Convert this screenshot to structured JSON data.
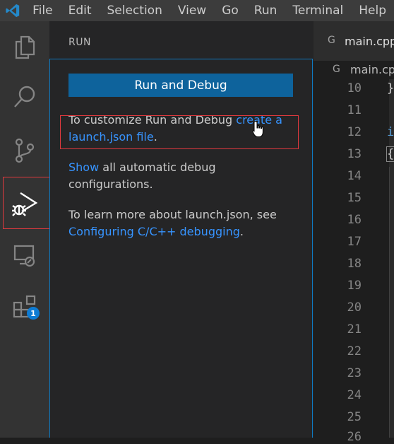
{
  "menu": {
    "items": [
      "File",
      "Edit",
      "Selection",
      "View",
      "Go",
      "Run",
      "Terminal",
      "Help"
    ]
  },
  "activity_bar": {
    "icons": [
      "explorer-icon",
      "search-icon",
      "source-control-icon",
      "run-debug-icon",
      "remote-explorer-icon",
      "extensions-icon"
    ],
    "extensions_badge": "1"
  },
  "sidebar": {
    "title": "RUN",
    "run_button_label": "Run and Debug",
    "customize_text": "To customize Run and Debug ",
    "customize_link": "create a launch.json file",
    "customize_end": ".",
    "show_link": "Show",
    "show_text": " all automatic debug configurations.",
    "learn_text": "To learn more about launch.json, see ",
    "learn_link": "Configuring C/C++ debugging",
    "learn_end": "."
  },
  "editor": {
    "tab_label": "main.cpp",
    "breadcrumb_label": "main.cpp",
    "line_numbers": [
      "10",
      "11",
      "12",
      "13",
      "14",
      "15",
      "16",
      "17",
      "18",
      "19",
      "20",
      "21",
      "22",
      "23",
      "24",
      "25",
      "26"
    ],
    "code_fragments": {
      "line10": "}",
      "line12": "i",
      "line13": "{"
    }
  },
  "colors": {
    "accent": "#0e639c",
    "link": "#3794ff",
    "highlight_box": "#e0393e",
    "badge": "#0e7cd4"
  }
}
